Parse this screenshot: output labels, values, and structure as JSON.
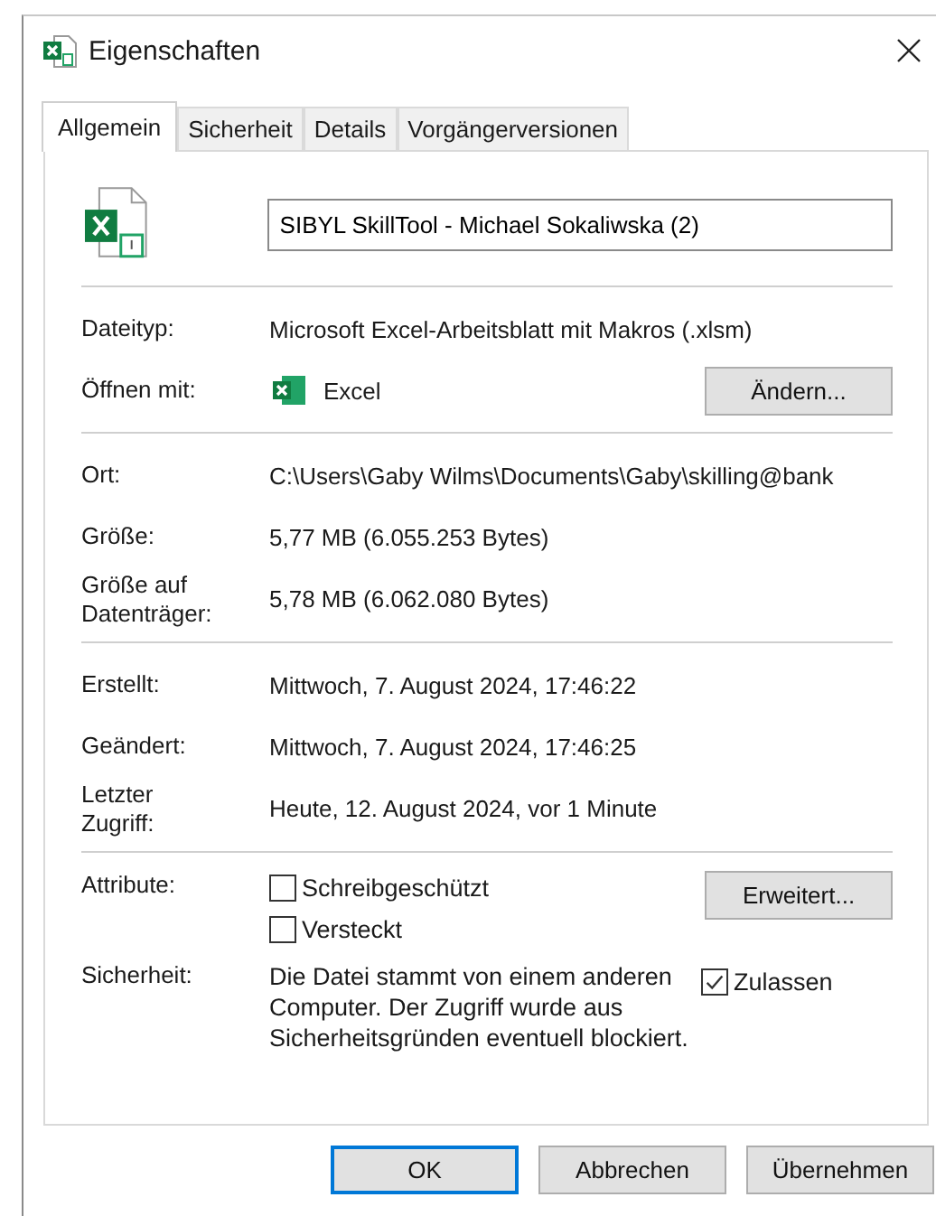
{
  "window": {
    "title": "Eigenschaften"
  },
  "tabs": [
    {
      "label": "Allgemein",
      "selected": true
    },
    {
      "label": "Sicherheit",
      "selected": false
    },
    {
      "label": "Details",
      "selected": false
    },
    {
      "label": "Vorgängerversionen",
      "selected": false
    }
  ],
  "file_name": {
    "value": "SIBYL SkillTool - Michael Sokaliwska (2)"
  },
  "sections": [
    {
      "rows": [
        {
          "kind": "text",
          "label": "Dateityp:",
          "value": "Microsoft Excel-Arbeitsblatt mit Makros (.xlsm)"
        },
        {
          "kind": "app",
          "label": "Öffnen mit:",
          "value": "Excel",
          "button": "Ändern..."
        }
      ]
    },
    {
      "rows": [
        {
          "kind": "text",
          "label": "Ort:",
          "value": "C:\\Users\\Gaby Wilms\\Documents\\Gaby\\skilling@bank"
        },
        {
          "kind": "text",
          "label": "Größe:",
          "value": "5,77 MB (6.055.253 Bytes)"
        },
        {
          "kind": "text",
          "label": "Größe auf Datenträger:",
          "value": "5,78 MB (6.062.080 Bytes)"
        }
      ]
    },
    {
      "rows": [
        {
          "kind": "text",
          "label": "Erstellt:",
          "value": "Mittwoch, 7. August 2024, 17:46:22"
        },
        {
          "kind": "text",
          "label": "Geändert:",
          "value": "Mittwoch, 7. August 2024, 17:46:25"
        },
        {
          "kind": "text",
          "label": "Letzter Zugriff:",
          "value": "Heute, 12. August 2024, vor 1 Minute"
        }
      ]
    }
  ],
  "attributes": {
    "label": "Attribute:",
    "options": [
      {
        "label": "Schreibgeschützt",
        "checked": false
      },
      {
        "label": "Versteckt",
        "checked": false
      }
    ],
    "button": "Erweitert..."
  },
  "security": {
    "label": "Sicherheit:",
    "text": "Die Datei stammt von einem anderen Computer. Der Zugriff wurde aus Sicherheitsgründen eventuell blockiert.",
    "allow": {
      "label": "Zulassen",
      "checked": true
    }
  },
  "buttons": [
    {
      "label": "OK",
      "default": true
    },
    {
      "label": "Abbrechen",
      "default": false
    },
    {
      "label": "Übernehmen",
      "default": false
    }
  ]
}
